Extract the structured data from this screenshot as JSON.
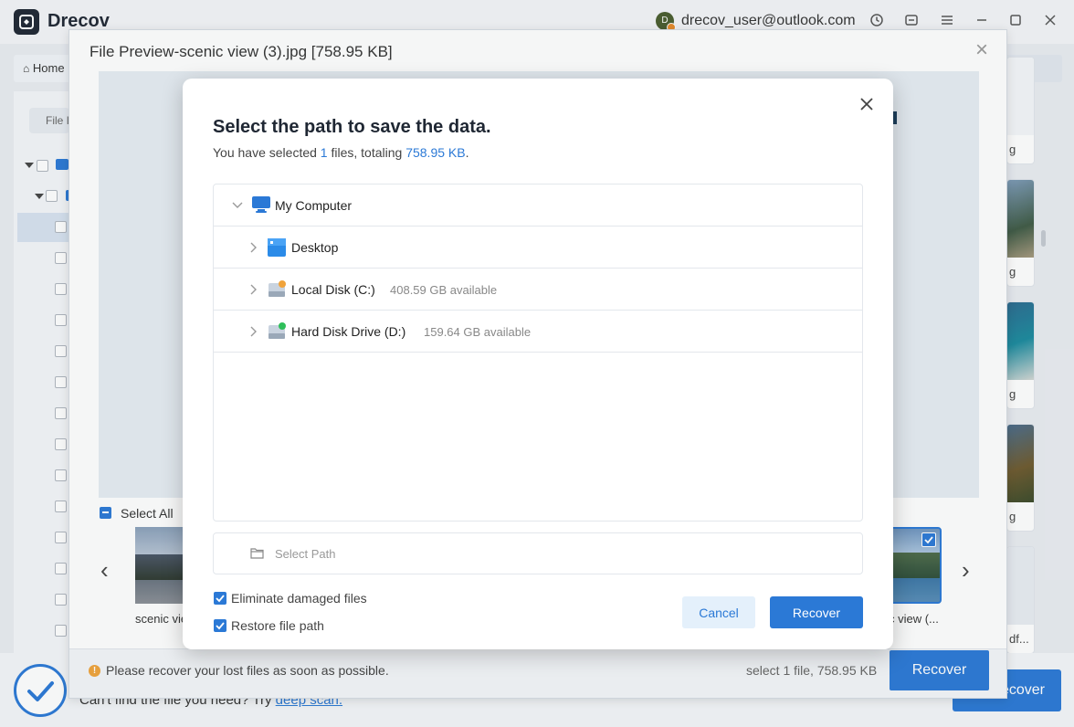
{
  "app": {
    "brand": "Drecov",
    "user_initial": "D",
    "user_email": "drecov_user@outlook.com",
    "home_tab": "Home",
    "file_tab": "File I",
    "deep_scan_prompt": "Can't find the file you need? Try",
    "deep_scan_link": "deep scan.",
    "recover_label": "Recover",
    "right_thumb_captions": [
      "g",
      "g",
      "g",
      "g",
      "df..."
    ]
  },
  "preview": {
    "title": "File Preview-scenic view (3).jpg [758.95 KB]",
    "select_all": "Select All",
    "thumb_captions": [
      "scenic vie",
      "c view (..."
    ],
    "warning": "Please recover your lost files as soon as possible.",
    "selection_info": "select 1 file, 758.95 KB",
    "recover_label": "Recover"
  },
  "dialog": {
    "title": "Select the path to save the data.",
    "subtitle_prefix": "You have selected ",
    "file_count": "1",
    "subtitle_mid": " files, totaling ",
    "total_size": "758.95 KB",
    "subtitle_suffix": ".",
    "tree": {
      "root": "My Computer",
      "items": [
        {
          "label": "Desktop",
          "available": ""
        },
        {
          "label": "Local Disk (C:)",
          "available": "408.59 GB available"
        },
        {
          "label": "Hard Disk Drive (D:)",
          "available": "159.64 GB available"
        }
      ]
    },
    "path_placeholder": "Select Path",
    "options": {
      "eliminate_damaged": {
        "label": "Eliminate damaged files",
        "checked": true
      },
      "restore_path": {
        "label": "Restore file path",
        "checked": true
      }
    },
    "cancel_label": "Cancel",
    "recover_label": "Recover"
  },
  "colors": {
    "accent": "#2b79d6",
    "dark": "#1f2733",
    "warning": "#f0a33b"
  }
}
